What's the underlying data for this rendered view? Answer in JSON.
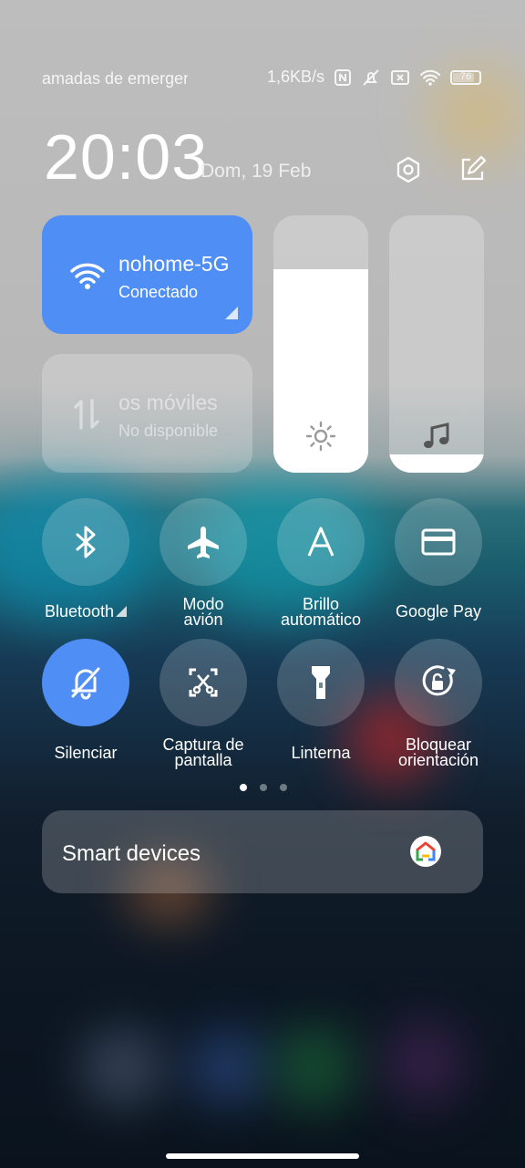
{
  "status_bar": {
    "notification_text": "amadas de emergen",
    "network_speed": "1,6KB/s",
    "battery_level": "76"
  },
  "header": {
    "time": "20:03",
    "date": "Dom, 19 Feb"
  },
  "wifi_tile": {
    "network_name": "nohome-5G",
    "status": "Conectado",
    "color": "#4e8ef5"
  },
  "mobile_data_tile": {
    "title": "os móviles",
    "status": "No disponible"
  },
  "sliders": {
    "brightness_level": 0.79,
    "volume_level": 0.07
  },
  "toggles": [
    {
      "label_1": "Bluetooth",
      "label_2": "",
      "icon": "bluetooth-icon",
      "active": false
    },
    {
      "label_1": "Modo",
      "label_2": "avión",
      "icon": "airplane-icon",
      "active": false
    },
    {
      "label_1": "Brillo",
      "label_2": "automático",
      "icon": "auto-brightness-icon",
      "active": false
    },
    {
      "label_1": "Google Pay",
      "label_2": "",
      "icon": "card-icon",
      "active": false
    },
    {
      "label_1": "Silenciar",
      "label_2": "",
      "icon": "bell-off-icon",
      "active": true
    },
    {
      "label_1": "Captura de",
      "label_2": "pantalla",
      "icon": "screenshot-icon",
      "active": false
    },
    {
      "label_1": "Linterna",
      "label_2": "",
      "icon": "flashlight-icon",
      "active": false
    },
    {
      "label_1": "Bloquear",
      "label_2": "orientación",
      "icon": "rotation-lock-icon",
      "active": false
    }
  ],
  "pager": {
    "pages": 3,
    "current": 1
  },
  "smart_devices": {
    "label": "Smart devices",
    "icon": "google-home-icon"
  }
}
